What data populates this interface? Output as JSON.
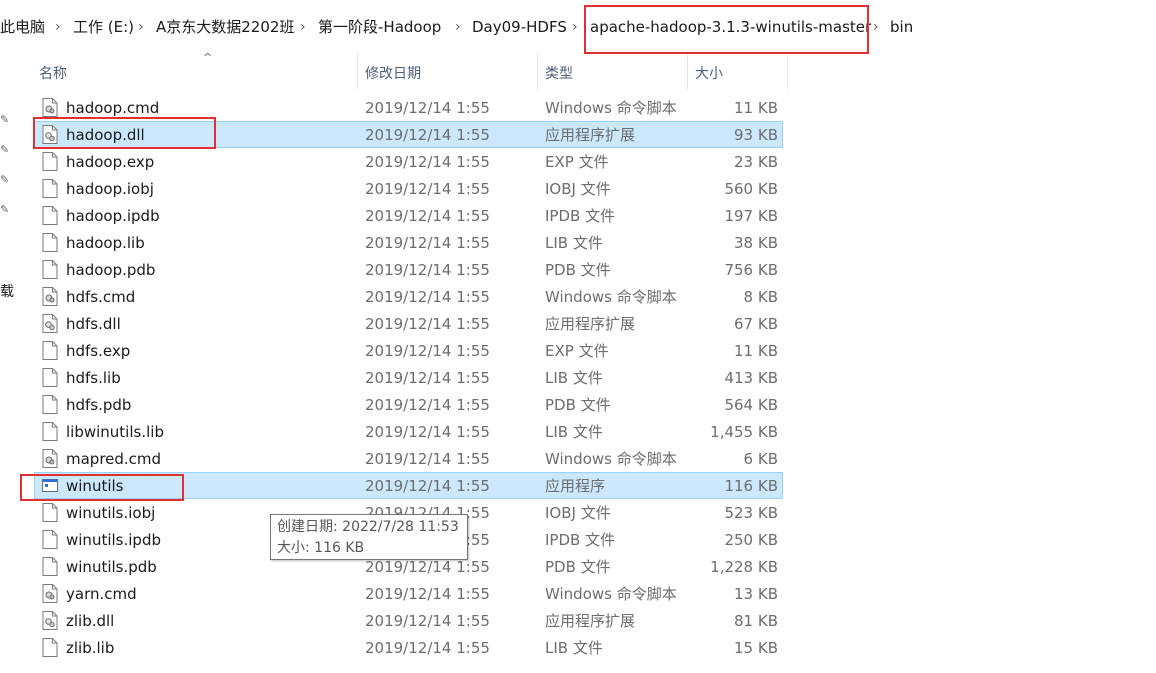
{
  "breadcrumb": [
    {
      "label": "此电脑"
    },
    {
      "label": "工作 (E:)"
    },
    {
      "label": "A京东大数据2202班"
    },
    {
      "label": "第一阶段-Hadoop"
    },
    {
      "label": "Day09-HDFS"
    },
    {
      "label": "apache-hadoop-3.1.3-winutils-master"
    },
    {
      "label": "bin"
    }
  ],
  "left_nav": {
    "partial_label": "载"
  },
  "columns": {
    "name": "名称",
    "date": "修改日期",
    "type": "类型",
    "size": "大小"
  },
  "files": [
    {
      "name": "hadoop.cmd",
      "date": "2019/12/14 1:55",
      "type": "Windows 命令脚本",
      "size": "11 KB",
      "icon": "cmd-file-icon",
      "selected": false
    },
    {
      "name": "hadoop.dll",
      "date": "2019/12/14 1:55",
      "type": "应用程序扩展",
      "size": "93 KB",
      "icon": "dll-file-icon",
      "selected": true
    },
    {
      "name": "hadoop.exp",
      "date": "2019/12/14 1:55",
      "type": "EXP 文件",
      "size": "23 KB",
      "icon": "generic-file-icon",
      "selected": false
    },
    {
      "name": "hadoop.iobj",
      "date": "2019/12/14 1:55",
      "type": "IOBJ 文件",
      "size": "560 KB",
      "icon": "generic-file-icon",
      "selected": false
    },
    {
      "name": "hadoop.ipdb",
      "date": "2019/12/14 1:55",
      "type": "IPDB 文件",
      "size": "197 KB",
      "icon": "generic-file-icon",
      "selected": false
    },
    {
      "name": "hadoop.lib",
      "date": "2019/12/14 1:55",
      "type": "LIB 文件",
      "size": "38 KB",
      "icon": "generic-file-icon",
      "selected": false
    },
    {
      "name": "hadoop.pdb",
      "date": "2019/12/14 1:55",
      "type": "PDB 文件",
      "size": "756 KB",
      "icon": "generic-file-icon",
      "selected": false
    },
    {
      "name": "hdfs.cmd",
      "date": "2019/12/14 1:55",
      "type": "Windows 命令脚本",
      "size": "8 KB",
      "icon": "cmd-file-icon",
      "selected": false
    },
    {
      "name": "hdfs.dll",
      "date": "2019/12/14 1:55",
      "type": "应用程序扩展",
      "size": "67 KB",
      "icon": "dll-file-icon",
      "selected": false
    },
    {
      "name": "hdfs.exp",
      "date": "2019/12/14 1:55",
      "type": "EXP 文件",
      "size": "11 KB",
      "icon": "generic-file-icon",
      "selected": false
    },
    {
      "name": "hdfs.lib",
      "date": "2019/12/14 1:55",
      "type": "LIB 文件",
      "size": "413 KB",
      "icon": "generic-file-icon",
      "selected": false
    },
    {
      "name": "hdfs.pdb",
      "date": "2019/12/14 1:55",
      "type": "PDB 文件",
      "size": "564 KB",
      "icon": "generic-file-icon",
      "selected": false
    },
    {
      "name": "libwinutils.lib",
      "date": "2019/12/14 1:55",
      "type": "LIB 文件",
      "size": "1,455 KB",
      "icon": "generic-file-icon",
      "selected": false
    },
    {
      "name": "mapred.cmd",
      "date": "2019/12/14 1:55",
      "type": "Windows 命令脚本",
      "size": "6 KB",
      "icon": "cmd-file-icon",
      "selected": false
    },
    {
      "name": "winutils",
      "date": "2019/12/14 1:55",
      "type": "应用程序",
      "size": "116 KB",
      "icon": "exe-file-icon",
      "selected": true
    },
    {
      "name": "winutils.iobj",
      "date": "2019/12/14 1:55",
      "type": "IOBJ 文件",
      "size": "523 KB",
      "icon": "generic-file-icon",
      "selected": false
    },
    {
      "name": "winutils.ipdb",
      "date": "2019/12/14 1:55",
      "type": "IPDB 文件",
      "size": "250 KB",
      "icon": "generic-file-icon",
      "selected": false
    },
    {
      "name": "winutils.pdb",
      "date": "2019/12/14 1:55",
      "type": "PDB 文件",
      "size": "1,228 KB",
      "icon": "generic-file-icon",
      "selected": false
    },
    {
      "name": "yarn.cmd",
      "date": "2019/12/14 1:55",
      "type": "Windows 命令脚本",
      "size": "13 KB",
      "icon": "cmd-file-icon",
      "selected": false
    },
    {
      "name": "zlib.dll",
      "date": "2019/12/14 1:55",
      "type": "应用程序扩展",
      "size": "81 KB",
      "icon": "dll-file-icon",
      "selected": false
    },
    {
      "name": "zlib.lib",
      "date": "2019/12/14 1:55",
      "type": "LIB 文件",
      "size": "15 KB",
      "icon": "generic-file-icon",
      "selected": false
    }
  ],
  "tooltip": {
    "created": "创建日期: 2022/7/28 11:53",
    "size": "大小: 116 KB"
  },
  "colors": {
    "selection": "#cce8ff",
    "highlight_box": "#e03030",
    "header_text": "#4c607a"
  }
}
